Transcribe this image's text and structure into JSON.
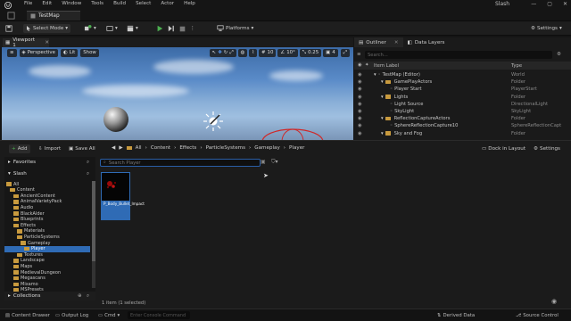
{
  "menu": [
    "File",
    "Edit",
    "Window",
    "Tools",
    "Build",
    "Select",
    "Actor",
    "Help"
  ],
  "project_name": "Slash",
  "level_tab": "TestMap",
  "toolbar": {
    "select_mode": "Select Mode",
    "platforms": "Platforms",
    "settings": "Settings"
  },
  "viewport": {
    "tab": "Viewport 1",
    "perspective": "Perspective",
    "lit": "Lit",
    "show": "Show",
    "grid_snap": "10",
    "rot_snap": "10°",
    "scale_snap": "0.25",
    "cam_speed": "4"
  },
  "outliner": {
    "tab": "Outliner",
    "data_layers_tab": "Data Layers",
    "search_placeholder": "Search...",
    "col_label": "Item Label",
    "col_type": "Type",
    "rows": [
      {
        "label": "TestMap (Editor)",
        "type": "World"
      },
      {
        "label": "GamePlayActors",
        "type": "Folder"
      },
      {
        "label": "Player Start",
        "type": "PlayerStart"
      },
      {
        "label": "Lights",
        "type": "Folder"
      },
      {
        "label": "Light Source",
        "type": "DirectionalLight"
      },
      {
        "label": "SkyLight",
        "type": "SkyLight"
      },
      {
        "label": "ReflectionCaptureActors",
        "type": "Folder"
      },
      {
        "label": "SphereReflectionCapture10",
        "type": "SphereReflectionCapt"
      },
      {
        "label": "Sky and Fog",
        "type": "Folder"
      }
    ]
  },
  "content_browser": {
    "add": "Add",
    "import": "Import",
    "save_all": "Save All",
    "breadcrumbs": [
      "All",
      "Content",
      "Effects",
      "ParticleSystems",
      "Gameplay",
      "Player"
    ],
    "dock": "Dock in Layout",
    "settings": "Settings",
    "favorites": "Favorites",
    "project": "Slash",
    "collections": "Collections",
    "search_placeholder": "Search Player",
    "tree": [
      {
        "label": "All",
        "indent": 0
      },
      {
        "label": "Content",
        "indent": 1
      },
      {
        "label": "AncientContent",
        "indent": 2
      },
      {
        "label": "AnimalVarietyPack",
        "indent": 2
      },
      {
        "label": "Audio",
        "indent": 2
      },
      {
        "label": "BlackAlder",
        "indent": 2
      },
      {
        "label": "Blueprints",
        "indent": 2
      },
      {
        "label": "Effects",
        "indent": 2
      },
      {
        "label": "Materials",
        "indent": 3
      },
      {
        "label": "ParticleSystems",
        "indent": 3
      },
      {
        "label": "Gameplay",
        "indent": 4
      },
      {
        "label": "Player",
        "indent": 5,
        "selected": true
      },
      {
        "label": "Textures",
        "indent": 3
      },
      {
        "label": "Landscape",
        "indent": 2
      },
      {
        "label": "Maps",
        "indent": 2
      },
      {
        "label": "MedievalDungeon",
        "indent": 2
      },
      {
        "label": "Megascans",
        "indent": 2
      },
      {
        "label": "Mixamo",
        "indent": 2
      },
      {
        "label": "MSPresets",
        "indent": 2
      }
    ],
    "asset_name": "P_Body_Bullet_Impact",
    "item_count": "1 item (1 selected)"
  },
  "statusbar": {
    "content_drawer": "Content Drawer",
    "output_log": "Output Log",
    "cmd": "Cmd",
    "console_placeholder": "Enter Console Command",
    "derived_data": "Derived Data",
    "source_control": "Source Control"
  },
  "colors": {
    "accent": "#2f6bb5",
    "play_green": "#4caf50",
    "folder": "#c89a3e"
  }
}
